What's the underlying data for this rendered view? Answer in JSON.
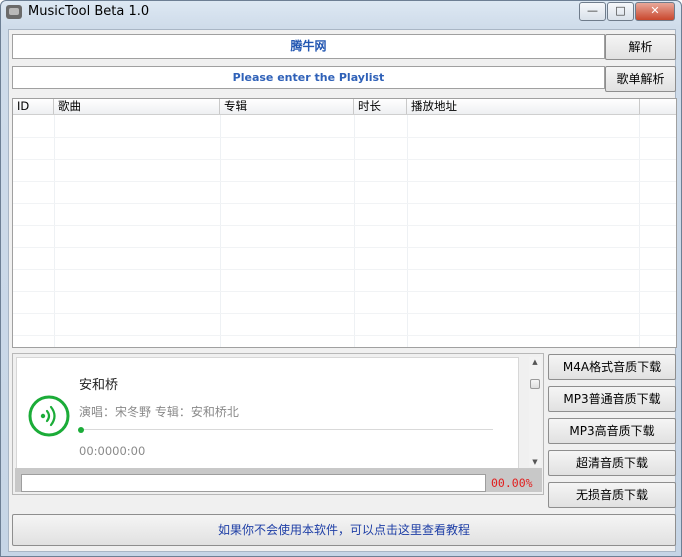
{
  "window": {
    "title": "MusicTool Beta 1.0",
    "controls": [
      "—",
      "□",
      "✕"
    ]
  },
  "url_row": {
    "value": "腾牛网",
    "button": "解析"
  },
  "playlist_row": {
    "value": "Please enter the Playlist",
    "button": "歌单解析"
  },
  "table": {
    "columns": [
      "ID",
      "歌曲",
      "专辑",
      "时长",
      "播放地址"
    ],
    "rows": []
  },
  "player": {
    "song": "安和桥",
    "meta": "演唱：宋冬野 专辑：安和桥北",
    "time": "00:0000:00",
    "progress": 0.0,
    "accent_color": "#1bac38"
  },
  "download_progress": {
    "percent_text": "00.00%",
    "percent_value": 0.0,
    "text_color": "#e21e1e"
  },
  "download_buttons": [
    "M4A格式音质下载",
    "MP3普通音质下载",
    "MP3高音质下载",
    "超清音质下载",
    "无损音质下载"
  ],
  "help_link": "如果你不会使用本软件，可以点击这里查看教程",
  "colors": {
    "link_blue": "#1f3fa6"
  }
}
